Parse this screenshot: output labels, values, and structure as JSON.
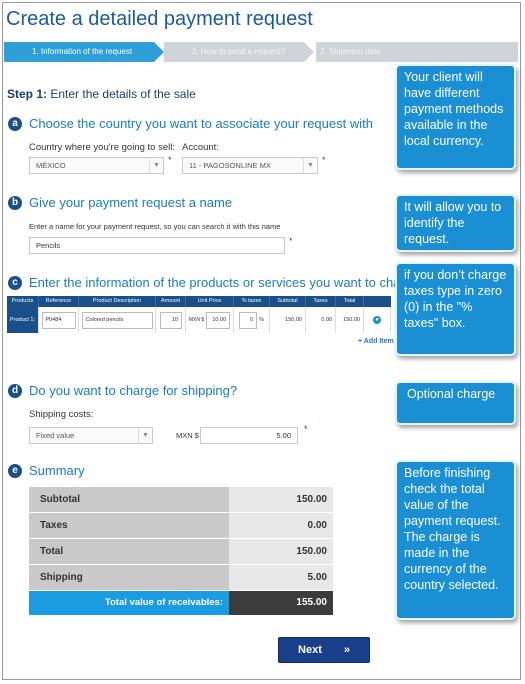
{
  "title": "Create a detailed payment request",
  "steps": [
    {
      "label": "1. Information of the request",
      "active": true
    },
    {
      "label": "2. How to send a request?",
      "active": false
    },
    {
      "label": "3. Shipment data",
      "active": false
    }
  ],
  "step1": {
    "prefix": "Step 1:",
    "text": "Enter the details of the sale"
  },
  "section_a": {
    "badge": "a",
    "heading": "Choose the country you want to associate your request with",
    "country_label": "Country where you're going to sell:",
    "country_value": "MÉXICO",
    "account_label": "Account:",
    "account_value": "11 - PAGOSONLINE MX"
  },
  "section_b": {
    "badge": "b",
    "heading": "Give your payment request a name",
    "hint": "Enter a name for your payment request, so you can search it with this name",
    "name_value": "Pencils"
  },
  "section_c": {
    "badge": "c",
    "heading": "Enter the information of the products or services you want to charge",
    "columns": [
      "Products",
      "Reference",
      "Product Description",
      "Amount",
      "Unit Price",
      "% taxes",
      "Subtotal",
      "Taxes",
      "Total"
    ],
    "row": {
      "product": "Product 1:",
      "reference": "P0484",
      "description": "Colored pencils",
      "amount": "10",
      "currency": "MXN $",
      "unit_price": "10.00",
      "taxes_pct": "0",
      "pct_sign": "%",
      "subtotal": "150.00",
      "taxes": "0.00",
      "total": "150.00"
    },
    "add_item": "+ Add Item"
  },
  "section_d": {
    "badge": "d",
    "heading": "Do you want to charge for shipping?",
    "shipping_label": "Shipping costs:",
    "shipping_type": "Fixed value",
    "currency": "MXN $",
    "shipping_value": "5.00"
  },
  "section_e": {
    "badge": "e",
    "heading": "Summary",
    "rows": [
      {
        "label": "Subtotal",
        "value": "150.00"
      },
      {
        "label": "Taxes",
        "value": "0.00"
      },
      {
        "label": "Total",
        "value": "150.00"
      },
      {
        "label": "Shipping",
        "value": "5.00"
      }
    ],
    "total_label": "Total value of receivables:",
    "total_value": "155.00"
  },
  "next_label": "Next",
  "next_chevron": "»",
  "required_mark": "*",
  "callouts": [
    "Your client will have different payment methods available in the local currency.",
    "It will allow you to identify the request.",
    "if you don’t charge taxes type in zero (0) in the \"% taxes\" box.",
    "Optional charge",
    "Before finishing check  the total value of the payment request. The charge is made in the currency of the country selected."
  ],
  "colors": {
    "brand_blue": "#1a4f8a",
    "accent_blue": "#1b8fd4",
    "active_step": "#2f9fd8"
  }
}
